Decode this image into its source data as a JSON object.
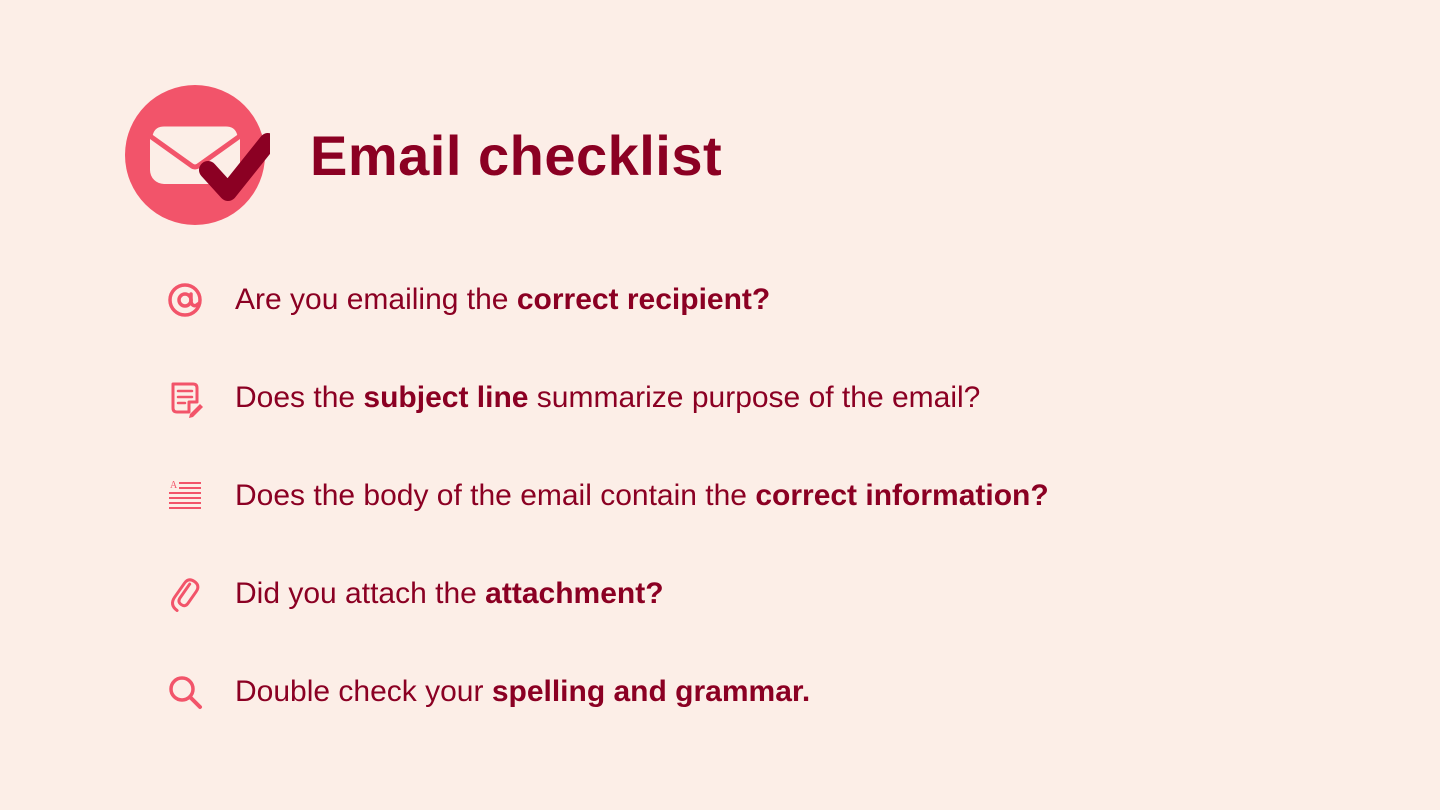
{
  "title": "Email checklist",
  "colors": {
    "bg": "#fceee7",
    "accent": "#f2546a",
    "dark": "#8b0023"
  },
  "items": [
    {
      "icon": "at",
      "prefix": "Are you emailing the ",
      "bold": "correct recipient?",
      "suffix": ""
    },
    {
      "icon": "note",
      "prefix": "Does the ",
      "bold": "subject line",
      "suffix": " summarize purpose of the email?"
    },
    {
      "icon": "lines",
      "prefix": "Does the body of the email contain the ",
      "bold": "correct information?",
      "suffix": ""
    },
    {
      "icon": "clip",
      "prefix": "Did you attach the ",
      "bold": "attachment?",
      "suffix": ""
    },
    {
      "icon": "magnify",
      "prefix": "Double check your ",
      "bold": "spelling and grammar.",
      "suffix": ""
    }
  ]
}
